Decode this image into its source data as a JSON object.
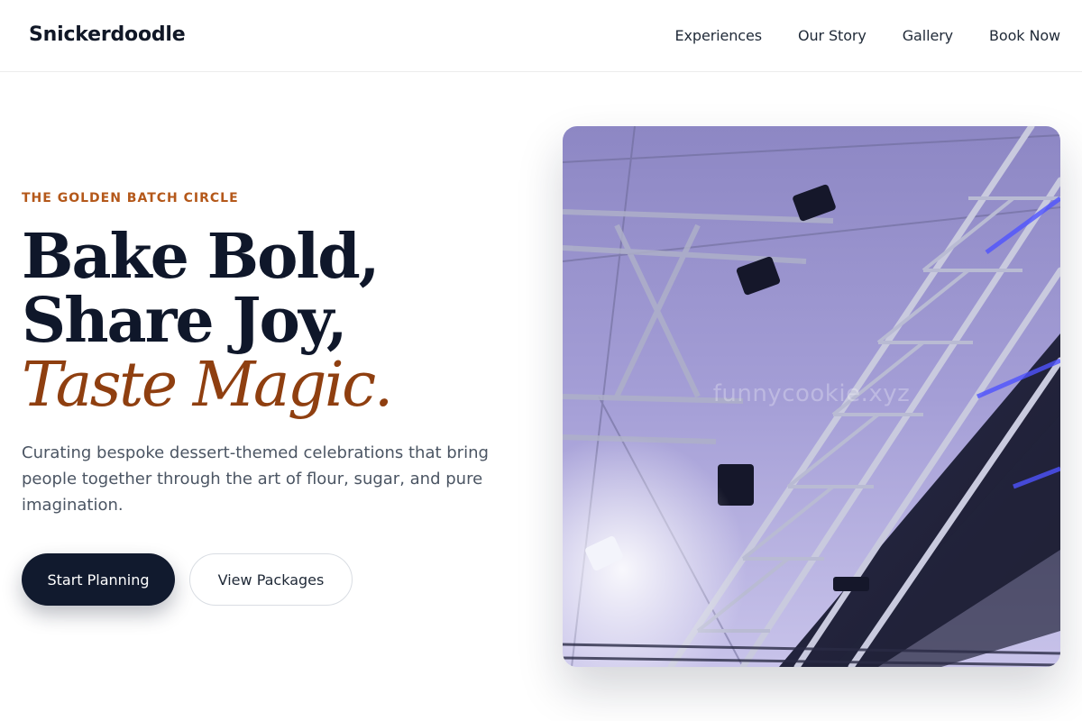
{
  "brand": {
    "name": "Snickerdoodle"
  },
  "nav": {
    "items": [
      {
        "label": "Experiences"
      },
      {
        "label": "Our Story"
      },
      {
        "label": "Gallery"
      },
      {
        "label": "Book Now"
      }
    ]
  },
  "hero": {
    "eyebrow": "THE GOLDEN BATCH CIRCLE",
    "headline": {
      "line1": "Bake Bold,",
      "line2": "Share Joy,",
      "line3": "Taste Magic."
    },
    "lead": "Curating bespoke dessert-themed celebrations that bring people together through the art of flour, sugar, and pure imagination.",
    "primary_cta": "Start Planning",
    "secondary_cta": "View Packages",
    "image": {
      "subject": "stage-lighting-truss-photo",
      "watermark": "funnycookie.xyz"
    }
  },
  "colors": {
    "accent": "#b4581a",
    "accent_dark": "#8f3f10",
    "ink": "#0f172a",
    "button_dark": "#111a2e",
    "body_text": "#4b5563"
  }
}
